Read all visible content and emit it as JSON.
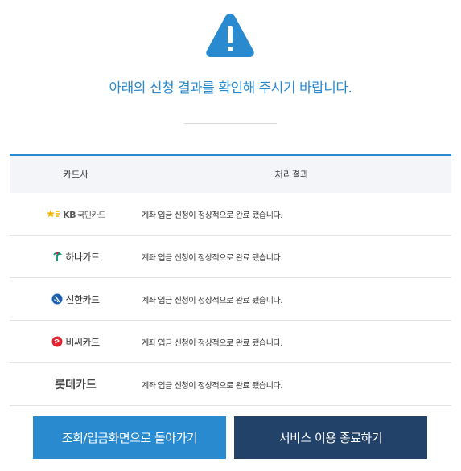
{
  "header": {
    "message": "아래의 신청 결과를 확인해 주시기 바랍니다."
  },
  "table": {
    "columns": [
      "카드사",
      "처리결과"
    ],
    "rows": [
      {
        "card": "KB국민카드",
        "card_main": "KB",
        "card_sub": "국민카드",
        "result": "계좌 입금 신청이 정상적으로 완료 됐습니다."
      },
      {
        "card": "하나카드",
        "result": "계좌 입금 신청이 정상적으로 완료 됐습니다."
      },
      {
        "card": "신한카드",
        "result": "계좌 입금 신청이 정상적으로 완료 됐습니다."
      },
      {
        "card": "비씨카드",
        "result": "계좌 입금 신청이 정상적으로 완료 됐습니다."
      },
      {
        "card": "롯데카드",
        "result": "계좌 입금 신청이 정상적으로 완료 됐습니다."
      }
    ]
  },
  "buttons": {
    "back": "조회/입금화면으로 돌아가기",
    "exit": "서비스 이용 종료하기"
  },
  "colors": {
    "accent": "#2a8ad0",
    "dark": "#23426a"
  },
  "icons": {
    "warning": "warning-triangle-icon"
  }
}
